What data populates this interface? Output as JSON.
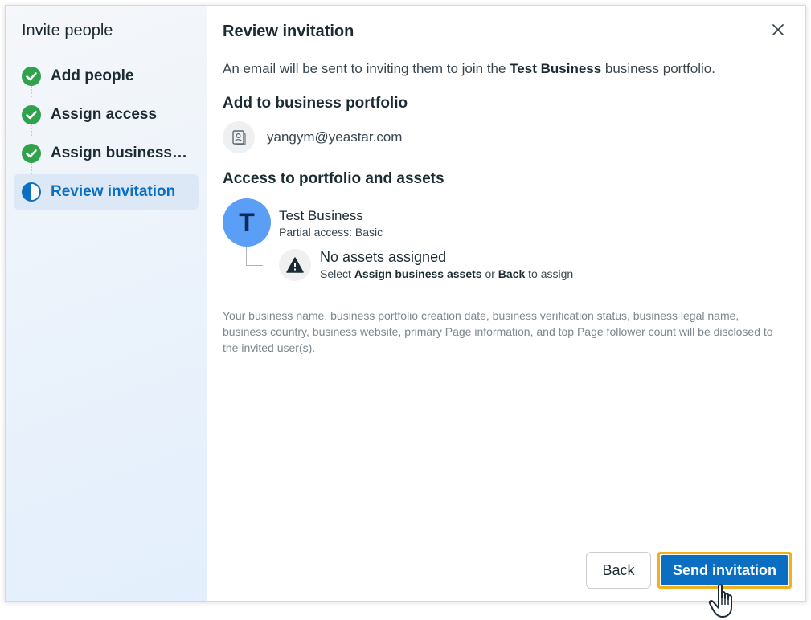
{
  "sidebar": {
    "title": "Invite people",
    "steps": [
      {
        "label": "Add people",
        "status": "complete",
        "icon": "check-circle-icon"
      },
      {
        "label": "Assign access",
        "status": "complete",
        "icon": "check-circle-icon"
      },
      {
        "label": "Assign business assets",
        "status": "complete",
        "icon": "check-circle-icon"
      },
      {
        "label": "Review invitation",
        "status": "current",
        "icon": "half-circle-icon"
      }
    ]
  },
  "main": {
    "title": "Review invitation",
    "intro_prefix": "An email will be sent to inviting them to join the ",
    "intro_business": "Test Business",
    "intro_suffix": " business portfolio.",
    "add_section_title": "Add to business portfolio",
    "email": "yangym@yeastar.com",
    "access_section_title": "Access to portfolio and assets",
    "business": {
      "avatar_letter": "T",
      "name": "Test Business",
      "access": "Partial access: Basic"
    },
    "assets": {
      "title": "No assets assigned",
      "hint_prefix": "Select ",
      "hint_link1": "Assign business assets",
      "hint_mid": " or ",
      "hint_link2": "Back",
      "hint_suffix": " to assign"
    },
    "disclaimer": "Your business name, business portfolio creation date, business verification status, business legal name, business country, business website, primary Page information, and top Page follower count will be disclosed to the invited user(s)."
  },
  "footer": {
    "back_label": "Back",
    "send_label": "Send invitation"
  },
  "colors": {
    "accent": "#0a6fc2",
    "success": "#31a24c",
    "highlight_outline": "#f2b01e",
    "avatar": "#5b9ef5"
  }
}
